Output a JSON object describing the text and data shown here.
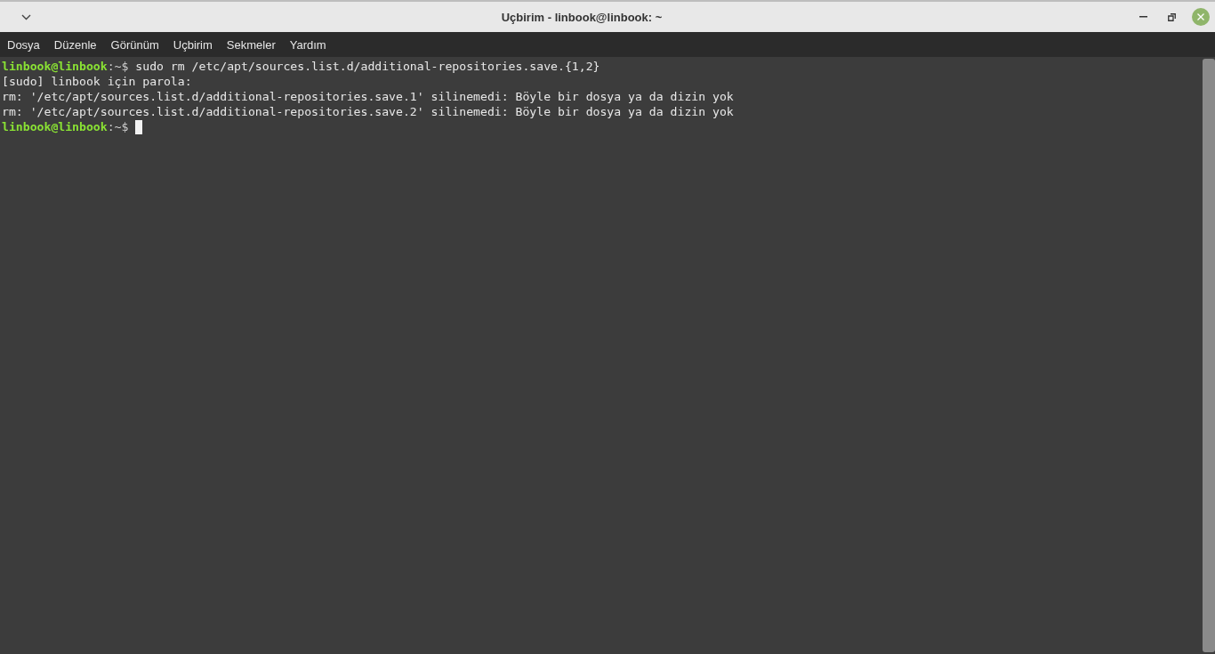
{
  "window": {
    "title": "Uçbirim - linbook@linbook: ~"
  },
  "menu": [
    "Dosya",
    "Düzenle",
    "Görünüm",
    "Uçbirim",
    "Sekmeler",
    "Yardım"
  ],
  "terminal": {
    "lines": [
      {
        "kind": "prompt",
        "user": "linbook@linbook",
        "path": ":~$",
        "command": " sudo rm /etc/apt/sources.list.d/additional-repositories.save.{1,2}",
        "cursor": false
      },
      {
        "kind": "output",
        "text": "[sudo] linbook için parola:"
      },
      {
        "kind": "output",
        "text": "rm: '/etc/apt/sources.list.d/additional-repositories.save.1' silinemedi: Böyle bir dosya ya da dizin yok"
      },
      {
        "kind": "output",
        "text": "rm: '/etc/apt/sources.list.d/additional-repositories.save.2' silinemedi: Böyle bir dosya ya da dizin yok"
      },
      {
        "kind": "prompt",
        "user": "linbook@linbook",
        "path": ":~$",
        "cursor": true
      }
    ]
  }
}
